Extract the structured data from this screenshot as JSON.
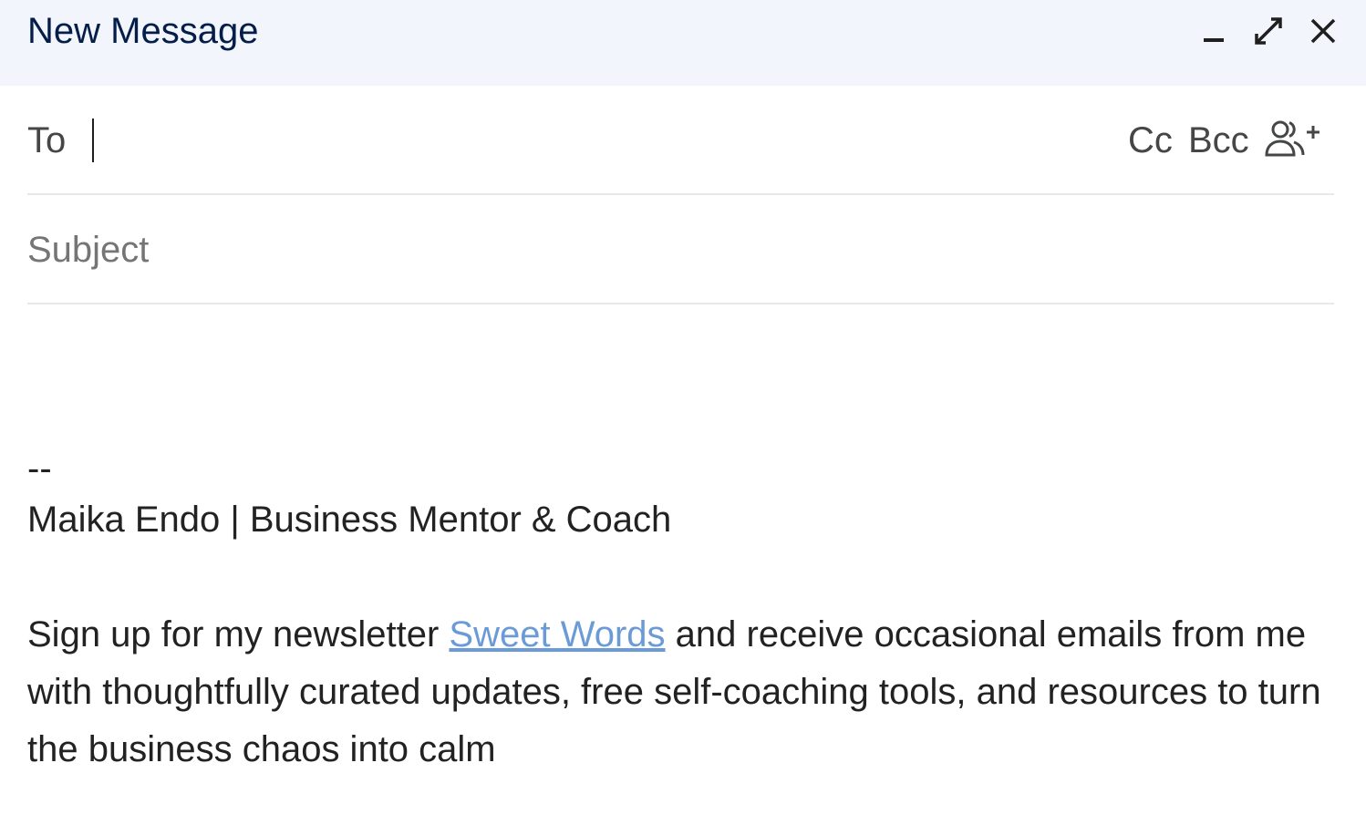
{
  "window": {
    "title": "New Message",
    "controls": {
      "minimize_icon": "minimize-icon",
      "fullscreen_icon": "expand-arrows-icon",
      "close_icon": "close-icon"
    }
  },
  "recipients": {
    "to_label": "To",
    "to_value": "",
    "cc_label": "Cc",
    "bcc_label": "Bcc",
    "add_people_icon": "people-add-icon"
  },
  "subject": {
    "placeholder": "Subject",
    "value": ""
  },
  "signature": {
    "dashes": "--",
    "name_line": "Maika Endo | Business Mentor & Coach",
    "para_before_link": "Sign up for my newsletter ",
    "link_text": "Sweet Words",
    "para_after_link": " and receive occasional emails from me with thoughtfully curated updates, free self-coaching tools, and resources to turn the business chaos into calm"
  },
  "colors": {
    "header_bg": "#f2f6fc",
    "title_text": "#041e49",
    "link": "#6b9bd6",
    "divider": "#e8e8e8"
  }
}
